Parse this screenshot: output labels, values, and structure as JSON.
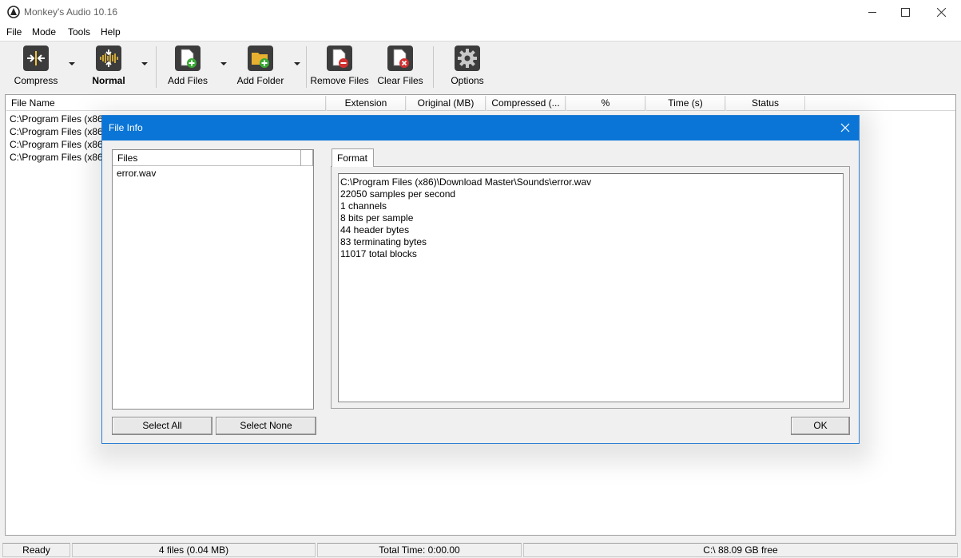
{
  "window": {
    "title": "Monkey's Audio 10.16"
  },
  "menu": [
    "File",
    "Mode",
    "Tools",
    "Help"
  ],
  "toolbar": {
    "compress": "Compress",
    "normal": "Normal",
    "add_files": "Add Files",
    "add_folder": "Add Folder",
    "remove_files": "Remove Files",
    "clear_files": "Clear Files",
    "options": "Options"
  },
  "list": {
    "columns": [
      "File Name",
      "Extension",
      "Original (MB)",
      "Compressed (...",
      "%",
      "Time (s)",
      "Status"
    ],
    "rows": [
      "C:\\Program Files (x86)",
      "C:\\Program Files (x86)",
      "C:\\Program Files (x86)",
      "C:\\Program Files (x86)"
    ]
  },
  "statusbar": {
    "ready": "Ready",
    "files": "4 files (0.04 MB)",
    "total_time": "Total Time: 0:00.00",
    "free": "C:\\ 88.09 GB free"
  },
  "dialog": {
    "title": "File Info",
    "files_header": "Files",
    "files": [
      "error.wav"
    ],
    "select_all": "Select All",
    "select_none": "Select None",
    "tab": "Format",
    "info_lines": [
      "C:\\Program Files (x86)\\Download Master\\Sounds\\error.wav",
      "22050 samples per second",
      "1 channels",
      "8 bits per sample",
      "44 header bytes",
      "83 terminating bytes",
      "11017 total blocks"
    ],
    "ok": "OK"
  },
  "colors": {
    "accent": "#0a75d6",
    "add_green": "#3aa935",
    "remove_red": "#d03030",
    "folder_yellow": "#e8b030"
  }
}
